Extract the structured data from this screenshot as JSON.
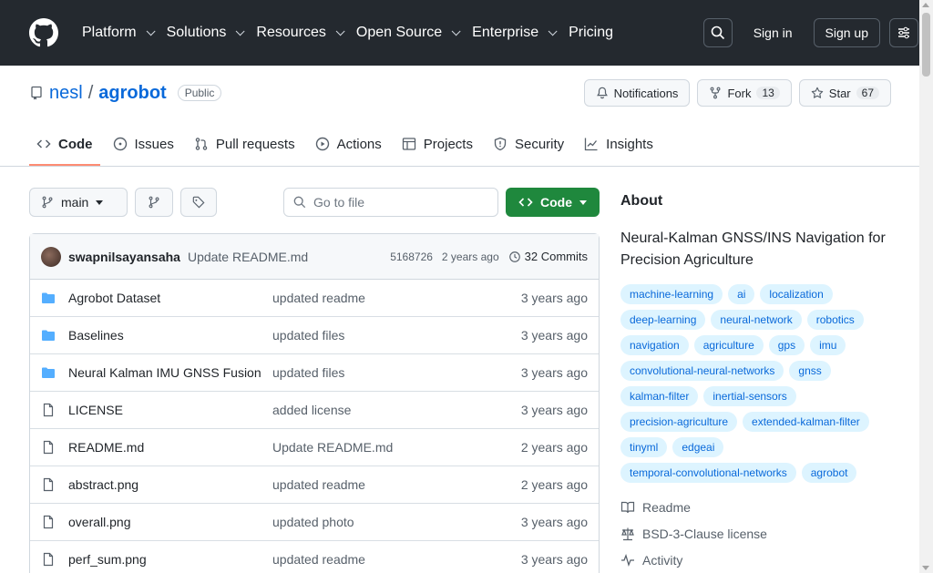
{
  "header": {
    "nav": [
      "Platform",
      "Solutions",
      "Resources",
      "Open Source",
      "Enterprise",
      "Pricing"
    ],
    "sign_in": "Sign in",
    "sign_up": "Sign up"
  },
  "repo": {
    "owner": "nesl",
    "separator": "/",
    "name": "agrobot",
    "visibility": "Public",
    "notifications": "Notifications",
    "fork_label": "Fork",
    "fork_count": "13",
    "star_label": "Star",
    "star_count": "67"
  },
  "tabs": [
    "Code",
    "Issues",
    "Pull requests",
    "Actions",
    "Projects",
    "Security",
    "Insights"
  ],
  "branch": {
    "name": "main",
    "goto_placeholder": "Go to file",
    "code_button": "Code"
  },
  "latest_commit": {
    "author": "swapnilsayansaha",
    "message": "Update README.md",
    "hash": "5168726",
    "age": "2 years ago",
    "commits": "32 Commits"
  },
  "files": [
    {
      "type": "folder",
      "name": "Agrobot Dataset",
      "message": "updated readme",
      "date": "3 years ago"
    },
    {
      "type": "folder",
      "name": "Baselines",
      "message": "updated files",
      "date": "3 years ago"
    },
    {
      "type": "folder",
      "name": "Neural Kalman IMU GNSS Fusion",
      "message": "updated files",
      "date": "3 years ago"
    },
    {
      "type": "file",
      "name": "LICENSE",
      "message": "added license",
      "date": "3 years ago"
    },
    {
      "type": "file",
      "name": "README.md",
      "message": "Update README.md",
      "date": "2 years ago"
    },
    {
      "type": "file",
      "name": "abstract.png",
      "message": "updated readme",
      "date": "2 years ago"
    },
    {
      "type": "file",
      "name": "overall.png",
      "message": "updated photo",
      "date": "3 years ago"
    },
    {
      "type": "file",
      "name": "perf_sum.png",
      "message": "updated readme",
      "date": "3 years ago"
    }
  ],
  "about": {
    "title": "About",
    "description": "Neural-Kalman GNSS/INS Navigation for Precision Agriculture",
    "topics": [
      "machine-learning",
      "ai",
      "localization",
      "deep-learning",
      "neural-network",
      "robotics",
      "navigation",
      "agriculture",
      "gps",
      "imu",
      "convolutional-neural-networks",
      "gnss",
      "kalman-filter",
      "inertial-sensors",
      "precision-agriculture",
      "extended-kalman-filter",
      "tinyml",
      "edgeai",
      "temporal-convolutional-networks",
      "agrobot"
    ],
    "readme": "Readme",
    "license": "BSD-3-Clause license",
    "activity": "Activity"
  }
}
